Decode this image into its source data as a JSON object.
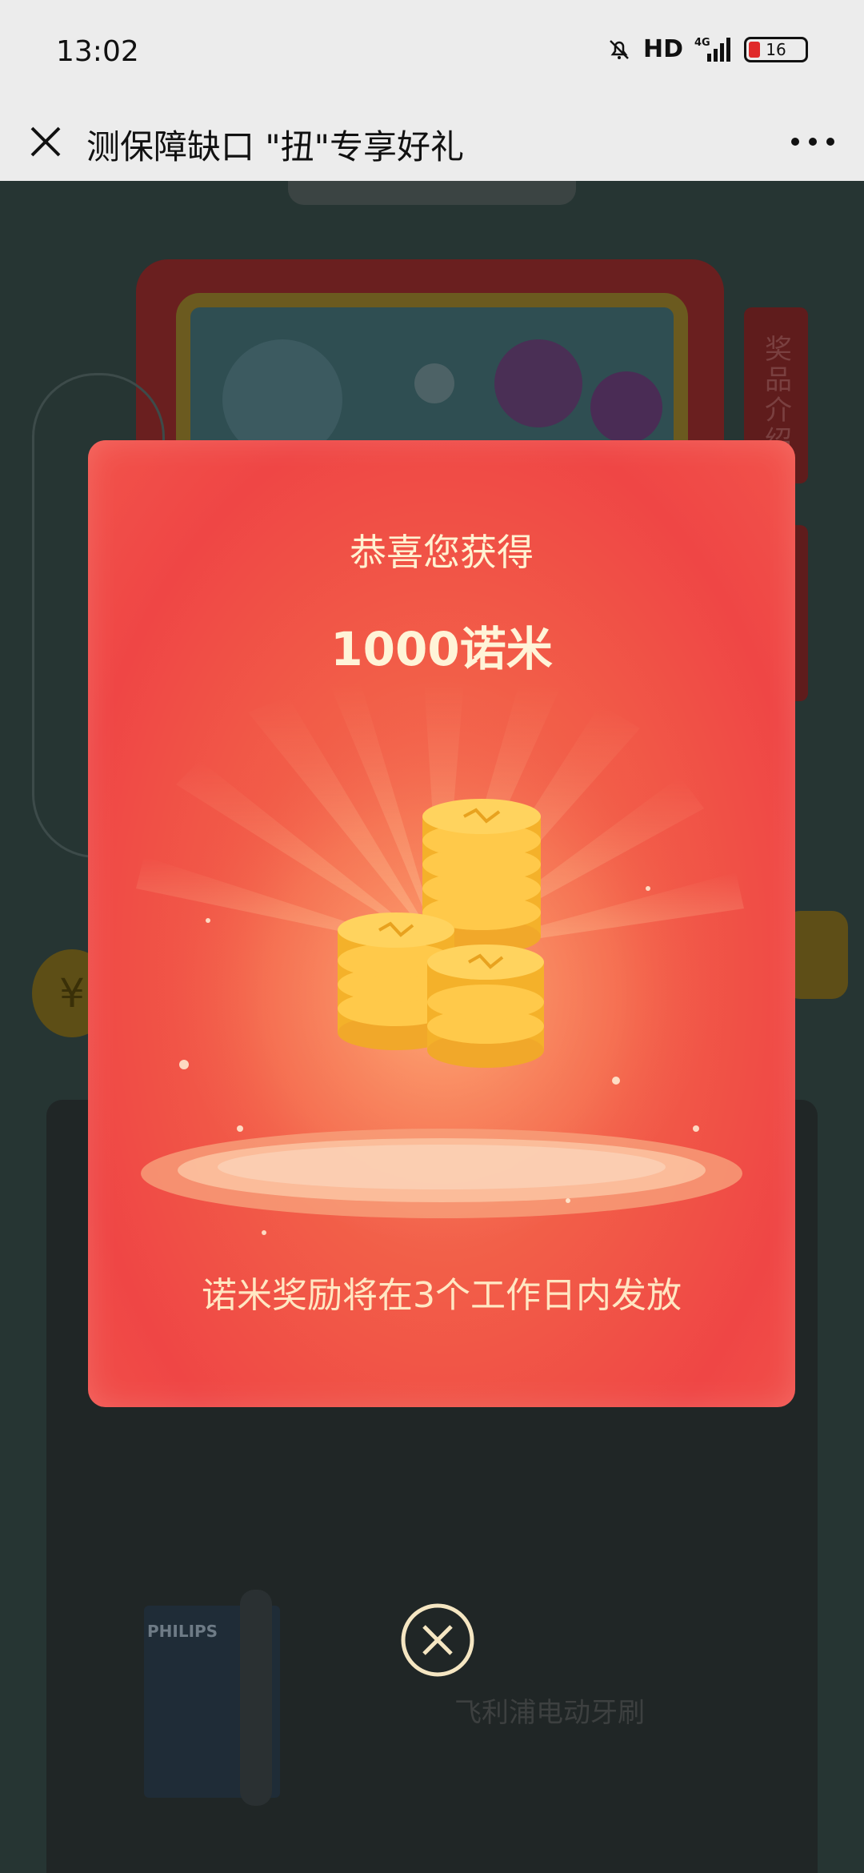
{
  "status_bar": {
    "time": "13:02",
    "network_label": "HD",
    "signal_label": "4G",
    "battery_level": "16"
  },
  "titlebar": {
    "title": "测保障缺口 \"扭\"专享好礼"
  },
  "background": {
    "side_tab_label": "奖品介绍",
    "product_name": "飞利浦电动牙刷",
    "product_brand": "PHILIPS"
  },
  "modal": {
    "headline": "恭喜您获得",
    "amount": "1000诺米",
    "notice": "诺米奖励将在3个工作日内发放"
  },
  "colors": {
    "modal_red": "#ef4645",
    "coin_gold": "#ffc23a",
    "text_cream": "#fff2d2"
  }
}
